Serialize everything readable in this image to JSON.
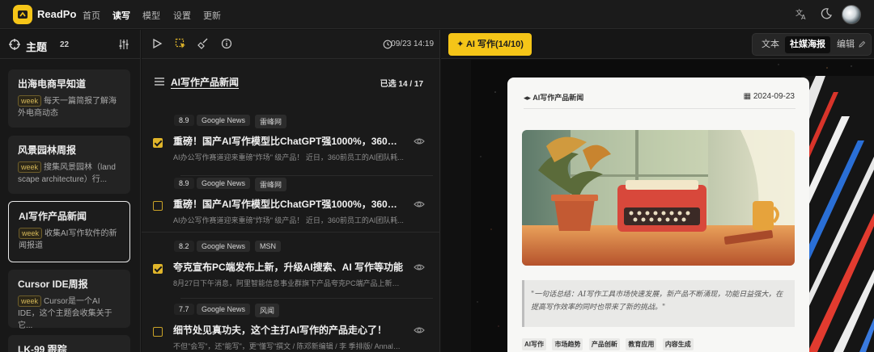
{
  "app": {
    "name": "ReadPo"
  },
  "nav": {
    "items": [
      "首页",
      "读写",
      "模型",
      "设置",
      "更新"
    ],
    "active": "读写"
  },
  "topbar_icons": [
    "translate-icon",
    "moon-icon",
    "avatar"
  ],
  "sidebar": {
    "title": "主题",
    "count": "22",
    "topics": [
      {
        "title": "出海电商早知道",
        "badge": "week",
        "desc": "每天一篇简报了解海外电商动态"
      },
      {
        "title": "风景园林周报",
        "badge": "week",
        "desc": "搜集风景园林（land scape architecture）行..."
      },
      {
        "title": "AI写作产品新闻",
        "badge": "week",
        "desc": "收集AI写作软件的新闻报道",
        "selected": true
      },
      {
        "title": "Cursor IDE周报",
        "badge": "week",
        "desc": "Cursor是一个AI IDE，这个主题会收集关于它..."
      },
      {
        "title": "LK-99 跟踪",
        "badge": "",
        "desc": ""
      }
    ]
  },
  "middle": {
    "timestamp": "09/23 14:19",
    "list_title": "AI写作产品新闻",
    "selected_label": "已选 14 / 17",
    "news": [
      {
        "score": "8.9",
        "tags": [
          "Google News",
          "雷峰网"
        ],
        "checked": true,
        "title": "重磅！国产AI写作模型比ChatGPT强1000%，360前...",
        "summary": "AI办公写作赛道迎来重磅\"炸场\" 级产品！ 近日，360前员工的AI团队耗..."
      },
      {
        "score": "8.9",
        "tags": [
          "Google News",
          "雷峰网"
        ],
        "checked": false,
        "title": "重磅！国产AI写作模型比ChatGPT强1000%，360前...",
        "summary": "AI办公写作赛道迎来重磅\"炸场\" 级产品！ 近日，360前员工的AI团队耗..."
      },
      {
        "score": "8.2",
        "tags": [
          "Google News",
          "MSN"
        ],
        "checked": true,
        "title": "夸克宣布PC端发布上新，升级AI搜索、AI 写作等功能",
        "summary": "8月27日下午消息，阿里智能信息事业群旗下产品夸克PC端产品上新，..."
      },
      {
        "score": "7.7",
        "tags": [
          "Google News",
          "风闻"
        ],
        "checked": false,
        "title": "细节处见真功夫，这个主打AI写作的产品走心了！",
        "summary": "不但\"会写\"，还\"能写\"，更\"懂写\"撰文 / 陈邓新编辑 / 李 季排版/ Annalee..."
      }
    ]
  },
  "right": {
    "ai_button": "AI 写作(14/10)",
    "segments": [
      "文本",
      "社媒海报",
      "编辑"
    ],
    "active_segment": "社媒海报",
    "poster": {
      "brand": "AI写作产品新闻",
      "date": "2024-09-23",
      "quote": "\"一句话总结：AI写作工具市场快速发展，新产品不断涌现，功能日益强大，在提高写作效率的同时也带来了新的挑战。\"",
      "tags": [
        "AI写作",
        "市场趋势",
        "产品创新",
        "教育应用",
        "内容生成"
      ]
    }
  },
  "colors": {
    "accent": "#f5c518",
    "background": "#141414",
    "poster_bg": "#f7f7f5"
  }
}
